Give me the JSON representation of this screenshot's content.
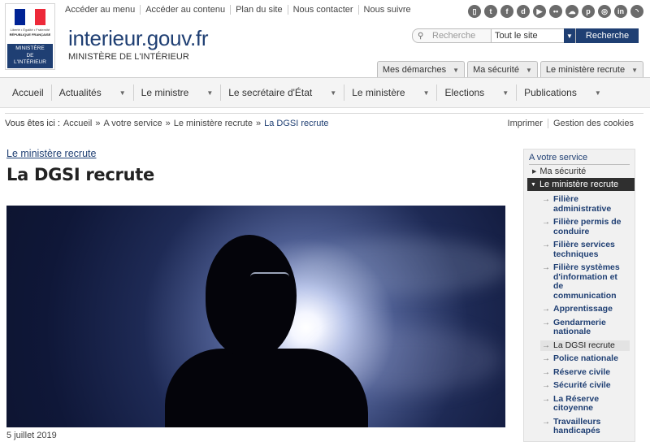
{
  "header": {
    "logo": {
      "motto": "Liberté • Égalité • Fraternité",
      "republic": "RÉPUBLIQUE FRANÇAISE",
      "ministry_lines": [
        "MINISTÈRE",
        "DE",
        "L'INTÉRIEUR"
      ],
      "flag_colors": [
        "#002395",
        "#ffffff",
        "#ed2939"
      ]
    },
    "skiplinks": [
      "Accéder au menu",
      "Accéder au contenu",
      "Plan du site",
      "Nous contacter",
      "Nous suivre"
    ],
    "social_icons": [
      "mobile-icon",
      "twitter-icon",
      "facebook-icon",
      "dailymotion-icon",
      "youtube-icon",
      "flickr-icon",
      "soundcloud-icon",
      "pinterest-icon",
      "instagram-icon",
      "linkedin-icon",
      "rss-icon"
    ],
    "site_title": "interieur.gouv.fr",
    "site_subtitle": "MINISTÈRE DE L'INTÉRIEUR",
    "search": {
      "placeholder": "Recherche",
      "scope": "Tout le site",
      "button": "Recherche"
    },
    "tabs": [
      "Mes démarches",
      "Ma sécurité",
      "Le ministère recrute"
    ]
  },
  "nav": {
    "items": [
      "Accueil",
      "Actualités",
      "Le ministre",
      "Le secrétaire d'État",
      "Le ministère",
      "Elections",
      "Publications"
    ]
  },
  "breadcrumb": {
    "prefix": "Vous êtes ici :",
    "items": [
      "Accueil",
      "»",
      "A votre service",
      "»",
      "Le ministère recrute",
      "»"
    ],
    "current": "La DGSI recrute"
  },
  "utils": [
    "Imprimer",
    "Gestion des cookies"
  ],
  "main": {
    "section": "Le ministère recrute",
    "title": "La DGSI recrute",
    "date": "5 juillet 2019"
  },
  "sidebar": {
    "heading": "A votre service",
    "level1": [
      "Ma sécurité"
    ],
    "active_level1": "Le ministère recrute",
    "items": [
      "Filière administrative",
      "Filière permis de conduire",
      "Filière services techniques",
      "Filière systèmes d'information et de communication",
      "Apprentissage",
      "Gendarmerie nationale",
      "La DGSI recrute",
      "Police nationale",
      "Réserve civile",
      "Sécurité civile",
      "La Réserve citoyenne",
      "Travailleurs handicapés"
    ],
    "active_item": "La DGSI recrute"
  },
  "colors": {
    "brand_blue": "#1f3f73",
    "nav_bg": "#f4f4f4",
    "sidebar_active": "#2f2f2f"
  }
}
